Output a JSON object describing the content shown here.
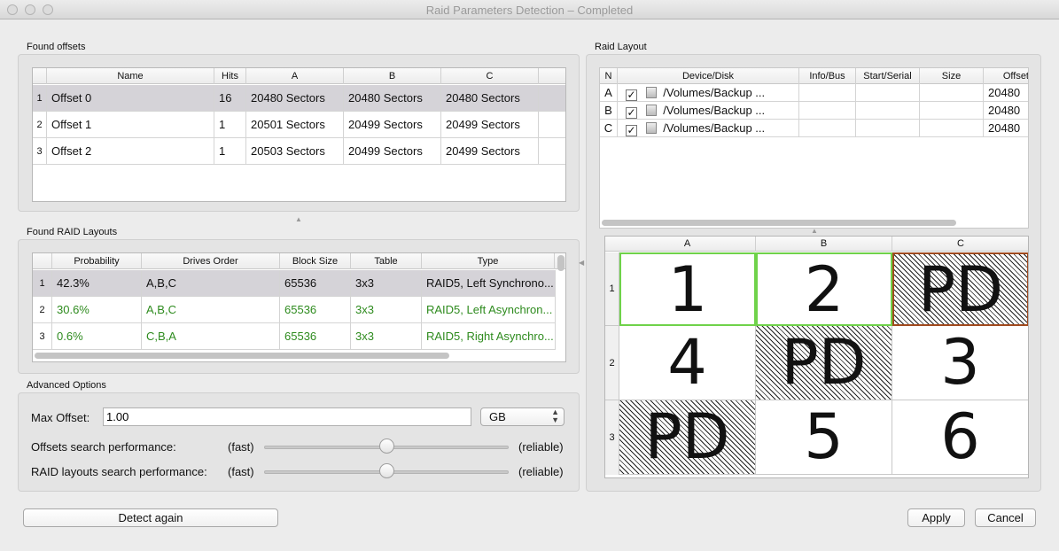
{
  "window": {
    "title": "Raid Parameters Detection – Completed"
  },
  "found_offsets": {
    "label": "Found offsets",
    "columns": [
      "Name",
      "Hits",
      "A",
      "B",
      "C"
    ],
    "rows": [
      {
        "n": "1",
        "name": "Offset 0",
        "hits": "16",
        "a": "20480 Sectors",
        "b": "20480 Sectors",
        "c": "20480 Sectors"
      },
      {
        "n": "2",
        "name": "Offset 1",
        "hits": "1",
        "a": "20501 Sectors",
        "b": "20499 Sectors",
        "c": "20499 Sectors"
      },
      {
        "n": "3",
        "name": "Offset 2",
        "hits": "1",
        "a": "20503 Sectors",
        "b": "20499 Sectors",
        "c": "20499 Sectors"
      }
    ]
  },
  "found_layouts": {
    "label": "Found RAID Layouts",
    "columns": [
      "Probability",
      "Drives Order",
      "Block Size",
      "Table",
      "Type"
    ],
    "rows": [
      {
        "n": "1",
        "prob": "42.3%",
        "order": "A,B,C",
        "block": "65536",
        "table": "3x3",
        "type": "RAID5, Left Synchrono..."
      },
      {
        "n": "2",
        "prob": "30.6%",
        "order": "A,B,C",
        "block": "65536",
        "table": "3x3",
        "type": "RAID5, Left Asynchron..."
      },
      {
        "n": "3",
        "prob": "0.6%",
        "order": "C,B,A",
        "block": "65536",
        "table": "3x3",
        "type": "RAID5, Right Asynchro..."
      }
    ]
  },
  "advanced": {
    "label": "Advanced Options",
    "max_offset_label": "Max Offset:",
    "max_offset_value": "1.00",
    "unit": "GB",
    "offsets_perf_label": "Offsets search performance:",
    "raid_perf_label": "RAID layouts search performance:",
    "fast": "(fast)",
    "reliable": "(reliable)",
    "offsets_perf_level": 0.5,
    "raid_perf_level": 0.5
  },
  "raid_layout": {
    "label": "Raid Layout",
    "columns": [
      "N",
      "Device/Disk",
      "Info/Bus",
      "Start/Serial",
      "Size",
      "Offset"
    ],
    "rows": [
      {
        "n": "A",
        "device": "/Volumes/Backup ...",
        "offset": "20480"
      },
      {
        "n": "B",
        "device": "/Volumes/Backup ...",
        "offset": "20480"
      },
      {
        "n": "C",
        "device": "/Volumes/Backup ...",
        "offset": "20480"
      }
    ],
    "grid_cols": [
      "A",
      "B",
      "C"
    ],
    "grid_rows": [
      "1",
      "2",
      "3"
    ],
    "grid": [
      [
        "1",
        "2",
        "PD"
      ],
      [
        "4",
        "PD",
        "3"
      ],
      [
        "PD",
        "5",
        "6"
      ]
    ]
  },
  "buttons": {
    "detect_again": "Detect again",
    "apply": "Apply",
    "cancel": "Cancel"
  }
}
